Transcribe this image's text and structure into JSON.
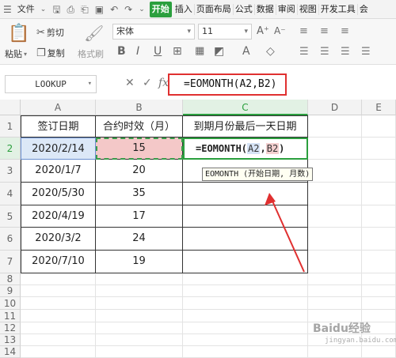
{
  "menubar": {
    "menu_label": "文件",
    "tabs": [
      "开始",
      "插入",
      "页面布局",
      "公式",
      "数据",
      "审阅",
      "视图",
      "开发工具",
      "会"
    ]
  },
  "ribbon": {
    "cut": "剪切",
    "paste": "粘贴",
    "copy": "复制",
    "format_painter": "格式刷",
    "font_name": "宋体",
    "font_size": "11"
  },
  "formula_bar": {
    "name_box": "LOOKUP",
    "formula": "=EOMONTH(A2,B2)"
  },
  "columns": [
    "A",
    "B",
    "C",
    "D",
    "E"
  ],
  "rows": [
    "1",
    "2",
    "3",
    "4",
    "5",
    "6",
    "7",
    "8",
    "9",
    "10",
    "11",
    "12",
    "13",
    "14"
  ],
  "table": {
    "headers": [
      "签订日期",
      "合约时效（月）",
      "到期月份最后一天日期"
    ],
    "data": [
      [
        "2020/2/14",
        "15"
      ],
      [
        "2020/1/7",
        "20"
      ],
      [
        "2020/5/30",
        "35"
      ],
      [
        "2020/4/19",
        "17"
      ],
      [
        "2020/3/2",
        "24"
      ],
      [
        "2020/7/10",
        "19"
      ]
    ]
  },
  "active_cell": {
    "prefix": "=EOMONTH(",
    "ref1": "A2",
    "sep": ",",
    "ref2": "B2",
    "suffix": ")"
  },
  "tooltip": "EOMONTH (开始日期, 月数)",
  "watermark": "Baidu经验",
  "watermark_sub": "jingyan.baidu.com",
  "colors": {
    "accent": "#2b9f3e",
    "annotation": "#e03030",
    "ref1_fill": "#dce8f7",
    "ref2_fill": "#f4c8c8"
  }
}
